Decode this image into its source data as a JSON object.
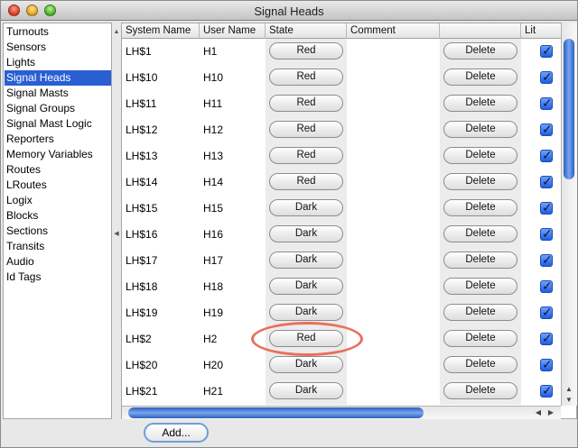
{
  "window": {
    "title": "Signal Heads"
  },
  "sidebar": {
    "items": [
      {
        "label": "Turnouts",
        "selected": false
      },
      {
        "label": "Sensors",
        "selected": false
      },
      {
        "label": "Lights",
        "selected": false
      },
      {
        "label": "Signal Heads",
        "selected": true
      },
      {
        "label": "Signal Masts",
        "selected": false
      },
      {
        "label": "Signal Groups",
        "selected": false
      },
      {
        "label": "Signal Mast Logic",
        "selected": false
      },
      {
        "label": "Reporters",
        "selected": false
      },
      {
        "label": "Memory Variables",
        "selected": false
      },
      {
        "label": "Routes",
        "selected": false
      },
      {
        "label": "LRoutes",
        "selected": false
      },
      {
        "label": "Logix",
        "selected": false
      },
      {
        "label": "Blocks",
        "selected": false
      },
      {
        "label": "Sections",
        "selected": false
      },
      {
        "label": "Transits",
        "selected": false
      },
      {
        "label": "Audio",
        "selected": false
      },
      {
        "label": "Id Tags",
        "selected": false
      }
    ]
  },
  "table": {
    "headers": {
      "system_name": "System Name",
      "user_name": "User Name",
      "state": "State",
      "comment": "Comment",
      "actions": "",
      "lit": "Lit"
    },
    "rows": [
      {
        "system_name": "LH$1",
        "user_name": "H1",
        "state": "Red",
        "comment": "",
        "delete": "Delete",
        "lit": true
      },
      {
        "system_name": "LH$10",
        "user_name": "H10",
        "state": "Red",
        "comment": "",
        "delete": "Delete",
        "lit": true
      },
      {
        "system_name": "LH$11",
        "user_name": "H11",
        "state": "Red",
        "comment": "",
        "delete": "Delete",
        "lit": true
      },
      {
        "system_name": "LH$12",
        "user_name": "H12",
        "state": "Red",
        "comment": "",
        "delete": "Delete",
        "lit": true
      },
      {
        "system_name": "LH$13",
        "user_name": "H13",
        "state": "Red",
        "comment": "",
        "delete": "Delete",
        "lit": true
      },
      {
        "system_name": "LH$14",
        "user_name": "H14",
        "state": "Red",
        "comment": "",
        "delete": "Delete",
        "lit": true
      },
      {
        "system_name": "LH$15",
        "user_name": "H15",
        "state": "Dark",
        "comment": "",
        "delete": "Delete",
        "lit": true
      },
      {
        "system_name": "LH$16",
        "user_name": "H16",
        "state": "Dark",
        "comment": "",
        "delete": "Delete",
        "lit": true
      },
      {
        "system_name": "LH$17",
        "user_name": "H17",
        "state": "Dark",
        "comment": "",
        "delete": "Delete",
        "lit": true
      },
      {
        "system_name": "LH$18",
        "user_name": "H18",
        "state": "Dark",
        "comment": "",
        "delete": "Delete",
        "lit": true
      },
      {
        "system_name": "LH$19",
        "user_name": "H19",
        "state": "Dark",
        "comment": "",
        "delete": "Delete",
        "lit": true
      },
      {
        "system_name": "LH$2",
        "user_name": "H2",
        "state": "Red",
        "comment": "",
        "delete": "Delete",
        "lit": true
      },
      {
        "system_name": "LH$20",
        "user_name": "H20",
        "state": "Dark",
        "comment": "",
        "delete": "Delete",
        "lit": true
      },
      {
        "system_name": "LH$21",
        "user_name": "H21",
        "state": "Dark",
        "comment": "",
        "delete": "Delete",
        "lit": true
      }
    ]
  },
  "footer": {
    "add_label": "Add..."
  },
  "colors": {
    "selection": "#2a5fd4",
    "highlight_ring": "#e8705a",
    "scroll_thumb": "#4a7fd6"
  },
  "icons": {
    "close": "close-icon",
    "minimize": "minimize-icon",
    "zoom": "zoom-icon",
    "check": "checkmark-icon"
  }
}
